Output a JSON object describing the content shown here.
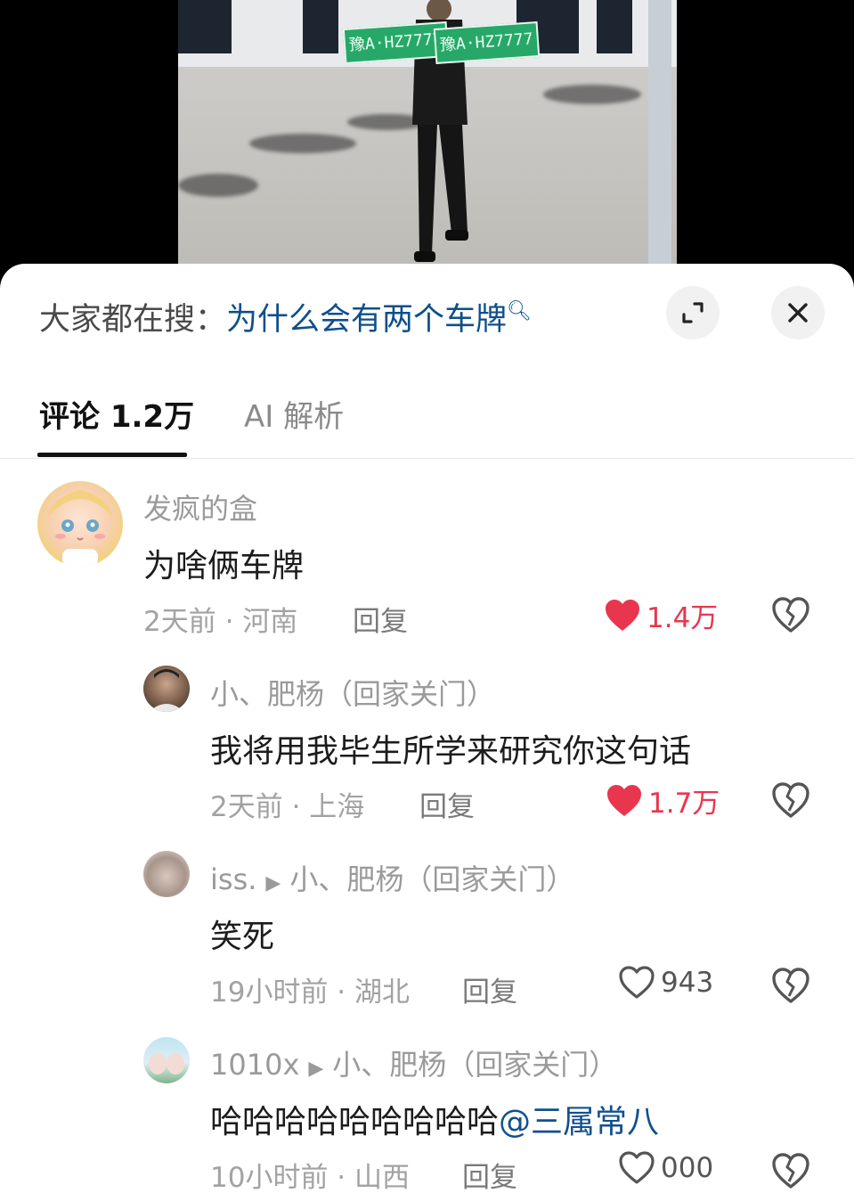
{
  "video": {
    "plate_text": "豫A·HZ7777"
  },
  "search_bar": {
    "prefix": "大家都在搜：",
    "query": "为什么会有两个车牌"
  },
  "tabs": [
    {
      "label": "评论 1.2万"
    },
    {
      "label": "AI 解析"
    }
  ],
  "comments": [
    {
      "user": "发疯的盒",
      "text": "为啥俩车牌",
      "time": "2天前 · 河南",
      "reply": "回复",
      "likes": "1.4万",
      "liked": true
    },
    {
      "user": "小、肥杨（回家关门）",
      "text": "我将用我毕生所学来研究你这句话",
      "time": "2天前 · 上海",
      "reply": "回复",
      "likes": "1.7万",
      "liked": true
    },
    {
      "user": "iss.",
      "reply_to": "小、肥杨（回家关门）",
      "text": "笑死",
      "time": "19小时前 · 湖北",
      "reply": "回复",
      "likes": "943",
      "liked": false
    },
    {
      "user": "1010x",
      "reply_to": "小、肥杨（回家关门）",
      "text": "哈哈哈哈哈哈哈哈哈",
      "mention": "@三属常八",
      "time": "10小时前 · 山西",
      "reply": "回复",
      "likes": "000",
      "liked": false
    }
  ],
  "colors": {
    "accent_like": "#e9364f",
    "link": "#12508f"
  }
}
